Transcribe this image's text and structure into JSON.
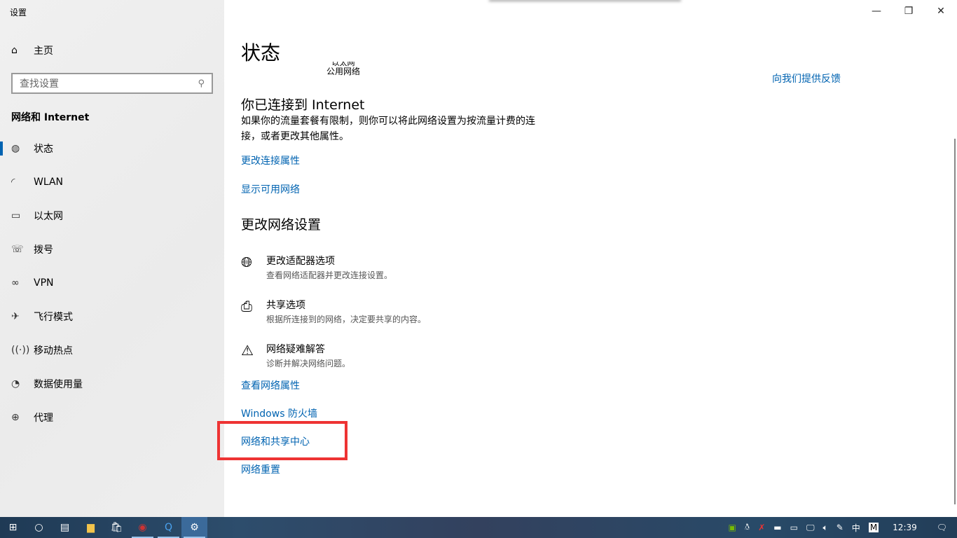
{
  "window": {
    "title": "设置",
    "minimize": "—",
    "maximize": "❐",
    "close": "✕"
  },
  "sidebar": {
    "home": "主页",
    "search_placeholder": "查找设置",
    "section": "网络和 Internet",
    "items": [
      {
        "label": "状态",
        "icon": "globe-icon",
        "glyph": "◍"
      },
      {
        "label": "WLAN",
        "icon": "wifi-icon",
        "glyph": "◜"
      },
      {
        "label": "以太网",
        "icon": "ethernet-icon",
        "glyph": "▭"
      },
      {
        "label": "拨号",
        "icon": "dialup-icon",
        "glyph": "☏"
      },
      {
        "label": "VPN",
        "icon": "vpn-icon",
        "glyph": "∞"
      },
      {
        "label": "飞行模式",
        "icon": "airplane-icon",
        "glyph": "✈"
      },
      {
        "label": "移动热点",
        "icon": "hotspot-icon",
        "glyph": "((·))"
      },
      {
        "label": "数据使用量",
        "icon": "data-usage-icon",
        "glyph": "◔"
      },
      {
        "label": "代理",
        "icon": "proxy-icon",
        "glyph": "⊕"
      }
    ]
  },
  "main": {
    "title": "状态",
    "ethernet_name": "以太网",
    "network_type": "公用网络",
    "feedback": "向我们提供反馈",
    "connected": "你已连接到 Internet",
    "description": "如果你的流量套餐有限制，则你可以将此网络设置为按流量计费的连接，或者更改其他属性。",
    "link_change_props": "更改连接属性",
    "link_show_networks": "显示可用网络",
    "change_heading": "更改网络设置",
    "options": [
      {
        "title": "更改适配器选项",
        "desc": "查看网络适配器并更改连接设置。"
      },
      {
        "title": "共享选项",
        "desc": "根据所连接到的网络，决定要共享的内容。"
      },
      {
        "title": "网络疑难解答",
        "desc": "诊断并解决网络问题。"
      }
    ],
    "links": [
      "查看网络属性",
      "Windows 防火墙",
      "网络和共享中心",
      "网络重置"
    ],
    "highlight_color": "#ee3333"
  },
  "taskbar": {
    "time": "12:39",
    "ime": "中",
    "ime_mode": "M"
  }
}
